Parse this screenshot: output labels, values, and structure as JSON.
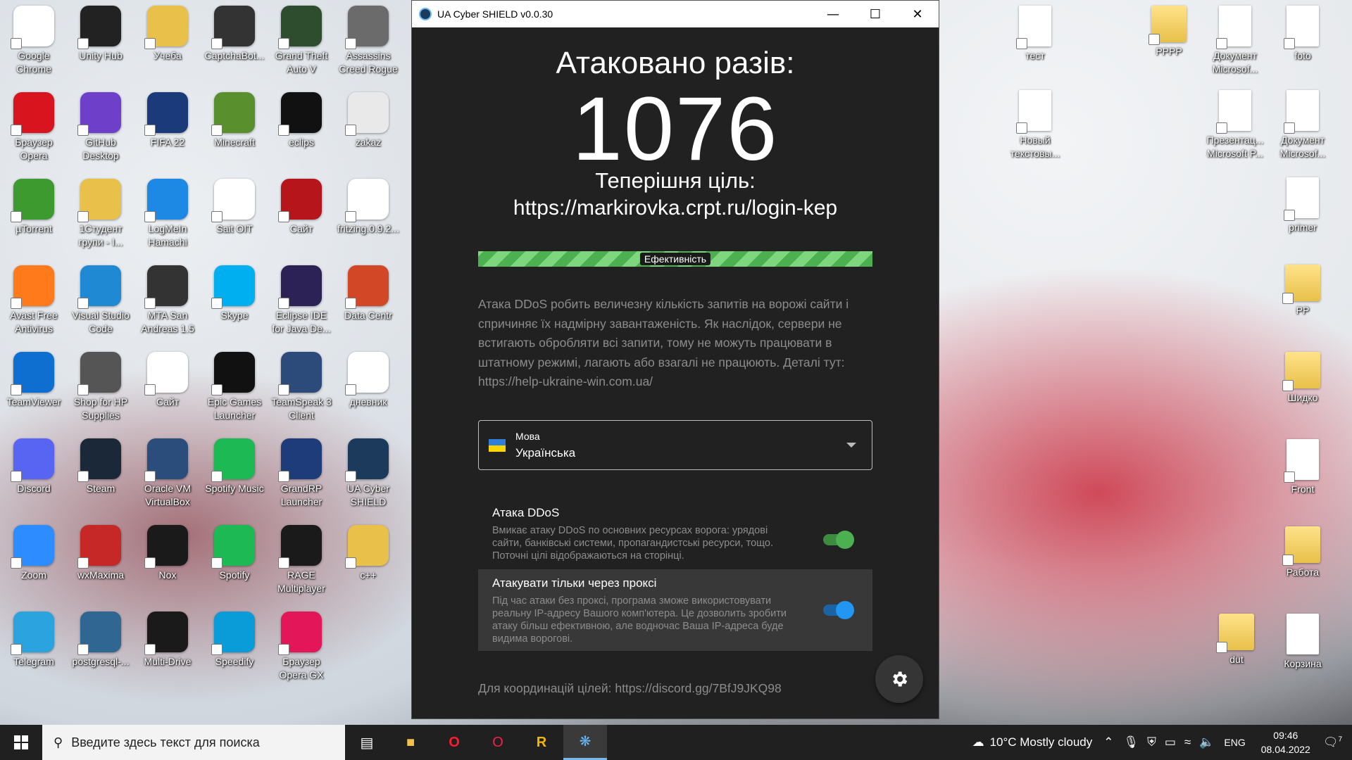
{
  "desktop": {
    "col1": [
      "Google Chrome",
      "Браузер Opera",
      "µTorrent",
      "Avast Free Antivirus",
      "TeamViewer",
      "Discord",
      "Zoom",
      "Telegram"
    ],
    "col2": [
      "Unity Hub",
      "GitHub Desktop",
      "1Студент групи - I...",
      "Visual Studio Code",
      "Shop for HP Supplies",
      "Steam",
      "wxMaxima",
      "postgresql-..."
    ],
    "col3": [
      "Учеба",
      "FIFA 22",
      "LogMeIn Hamachi",
      "MTA San Andreas 1.5",
      "Сайт",
      "Oracle VM VirtualBox",
      "Nox",
      "Multi-Drive"
    ],
    "col4": [
      "CaptchaBot...",
      "Minecraft",
      "Sait OIT",
      "Skype",
      "Epic Games Launcher",
      "Spotify Music",
      "Spotify",
      "Speedify"
    ],
    "col5": [
      "Grand Theft Auto V",
      "eclips",
      "Сайт",
      "Eclipse IDE for Java De...",
      "TeamSpeak 3 Client",
      "GrandRP Launcher",
      "RAGE Multiplayer",
      "Браузер Opera GX"
    ],
    "col6": [
      "Assassins Creed Rogue",
      "zakaz",
      "fritzing.0.9.2...",
      "Data Centr",
      "дневник",
      "UA Cyber SHIELD",
      "c++"
    ],
    "right": [
      {
        "label": "тест"
      },
      {
        "label": "РРРР"
      },
      {
        "label": "Документ Microsof..."
      },
      {
        "label": "foto"
      },
      {
        "label": "Новый текстовы..."
      },
      {
        "label": "Презентац... Microsoft P..."
      },
      {
        "label": "Документ Microsof..."
      },
      {
        "label": "primer"
      },
      {
        "label": "PP"
      },
      {
        "label": "Шидко"
      },
      {
        "label": "Front"
      },
      {
        "label": "Работа"
      },
      {
        "label": "dut"
      },
      {
        "label": "Корзина"
      }
    ]
  },
  "window": {
    "title": "UA Cyber SHIELD v0.0.30",
    "attacked_label": "Атаковано разів:",
    "attack_count": "1076",
    "target_label": "Теперішня ціль:",
    "target_url": "https://markirovka.crpt.ru/login-kep",
    "efficiency_label": "Ефективність",
    "efficiency_percent": 100,
    "description": "Атака DDoS робить величезну кількість запитів на ворожі сайти і спричиняє їх надмірну завантаженість. Як наслідок, сервери не встигають обробляти всі запити, тому не можуть працювати в штатному режимі, лагають або взагалі не працюють. Деталі тут: https://help-ukraine-win.com.ua/",
    "language": {
      "caption": "Мова",
      "value": "Українська"
    },
    "option_ddos": {
      "title": "Атака DDoS",
      "desc": "Вмикає атаку DDoS по основних ресурсах ворога: урядові сайти, банківські системи, пропагандистські ресурси, тощо. Поточні цілі відображаються на сторінці.",
      "enabled": true
    },
    "option_proxy": {
      "title": "Атакувати тільки через проксі",
      "desc": "Під час атаки без проксі, програма зможе використовувати реальну IP-адресу Вашого комп'ютера. Це дозволить зробити атаку більш ефективною, але водночас Ваша IP-адреса буде видима ворогові.",
      "enabled": true
    },
    "footer": "Для координацій цілей: https://discord.gg/7BfJ9JKQ98"
  },
  "taskbar": {
    "search_placeholder": "Введите здесь текст для поиска",
    "weather": "10°C  Mostly cloudy",
    "lang": "ENG",
    "time": "09:46",
    "date": "08.04.2022",
    "notifications": "7"
  },
  "colors": {
    "window_bg": "#212121",
    "accent_green": "#4caf50",
    "accent_blue": "#2196f3"
  }
}
